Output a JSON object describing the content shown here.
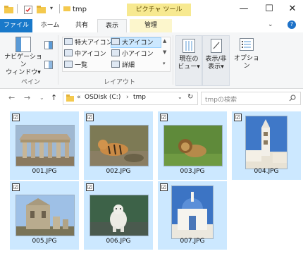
{
  "window": {
    "title": "tmp",
    "context_tab": "ピクチャ ツール",
    "controls": {
      "minimize": "—",
      "maximize": "☐",
      "close": "✕"
    }
  },
  "ribbon_tabs": {
    "file": "ファイル",
    "home": "ホーム",
    "share": "共有",
    "view": "表示",
    "manage": "管理"
  },
  "ribbon": {
    "pane_group": {
      "nav_pane_line1": "ナビゲーション",
      "nav_pane_line2": "ウィンドウ▾",
      "label": "ペイン"
    },
    "layout_group": {
      "extra_large": "特大アイコン",
      "large": "大アイコン",
      "medium": "中アイコン",
      "small": "小アイコン",
      "list": "一覧",
      "details": "詳細",
      "label": "レイアウト"
    },
    "current_view_line1": "現在の",
    "current_view_line2": "ビュー▾",
    "show_hide_line1": "表示/非",
    "show_hide_line2": "表示▾",
    "options": "オプション"
  },
  "address_bar": {
    "prefix": "«",
    "drive": "OSDisk (C:)",
    "separator": "›",
    "folder": "tmp",
    "search_placeholder": "tmpの検索"
  },
  "files": [
    {
      "name": "001.JPG",
      "checked": "☑",
      "icon": "temple-photo"
    },
    {
      "name": "002.JPG",
      "checked": "☑",
      "icon": "tiger-photo"
    },
    {
      "name": "003.JPG",
      "checked": "☑",
      "icon": "lion-photo"
    },
    {
      "name": "004.JPG",
      "checked": "☑",
      "icon": "tower-photo"
    },
    {
      "name": "005.JPG",
      "checked": "☑",
      "icon": "ruin-photo"
    },
    {
      "name": "006.JPG",
      "checked": "☑",
      "icon": "polar-bear-photo"
    },
    {
      "name": "007.JPG",
      "checked": "☑",
      "icon": "chapel-photo"
    }
  ],
  "colors": {
    "accent": "#1979ca",
    "selection": "#cce8ff",
    "context": "#f7e990"
  }
}
